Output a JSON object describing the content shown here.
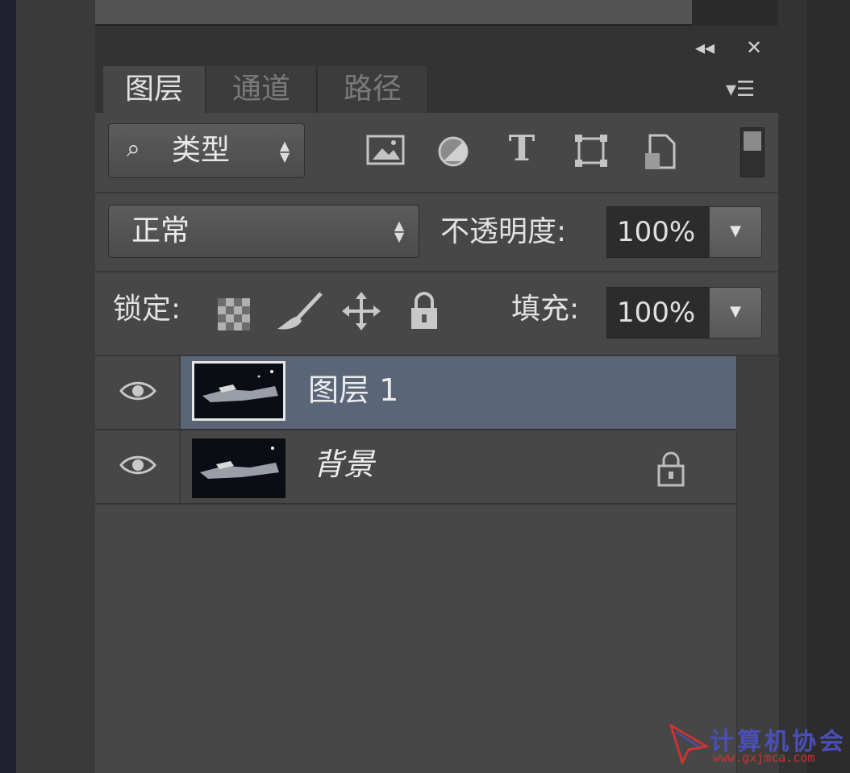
{
  "panel": {
    "collapse_glyph": "◂◂",
    "close_glyph": "✕",
    "menu_glyph": "▾☰"
  },
  "tabs": [
    {
      "label": "图层",
      "active": true
    },
    {
      "label": "通道",
      "active": false
    },
    {
      "label": "路径",
      "active": false
    }
  ],
  "filter": {
    "search_icon": "search-icon",
    "kind_label": "类型",
    "icons": [
      "pixel-layer-filter-icon",
      "adjustment-layer-filter-icon",
      "type-layer-filter-icon",
      "shape-layer-filter-icon",
      "smart-object-filter-icon",
      "filter-toggle-switch"
    ],
    "type_glyph": "T"
  },
  "blend": {
    "mode": "正常",
    "opacity_label": "不透明度:",
    "opacity_value": "100%"
  },
  "lock": {
    "label": "锁定:",
    "icons": [
      "lock-transparent-pixels-icon",
      "lock-image-pixels-icon",
      "lock-position-icon",
      "lock-all-icon"
    ],
    "fill_label": "填充:",
    "fill_value": "100%"
  },
  "layers": [
    {
      "name": "图层 1",
      "visible": true,
      "selected": true,
      "locked": false
    },
    {
      "name": "背景",
      "visible": true,
      "selected": false,
      "locked": true
    }
  ],
  "watermark": {
    "title": "计算机协会",
    "url": "www.gxjmca.com"
  },
  "colors": {
    "panel_bg": "#474747",
    "selected_layer": "#5a6678",
    "watermark_blue": "#4a4fb8",
    "watermark_red": "#cc3333"
  }
}
